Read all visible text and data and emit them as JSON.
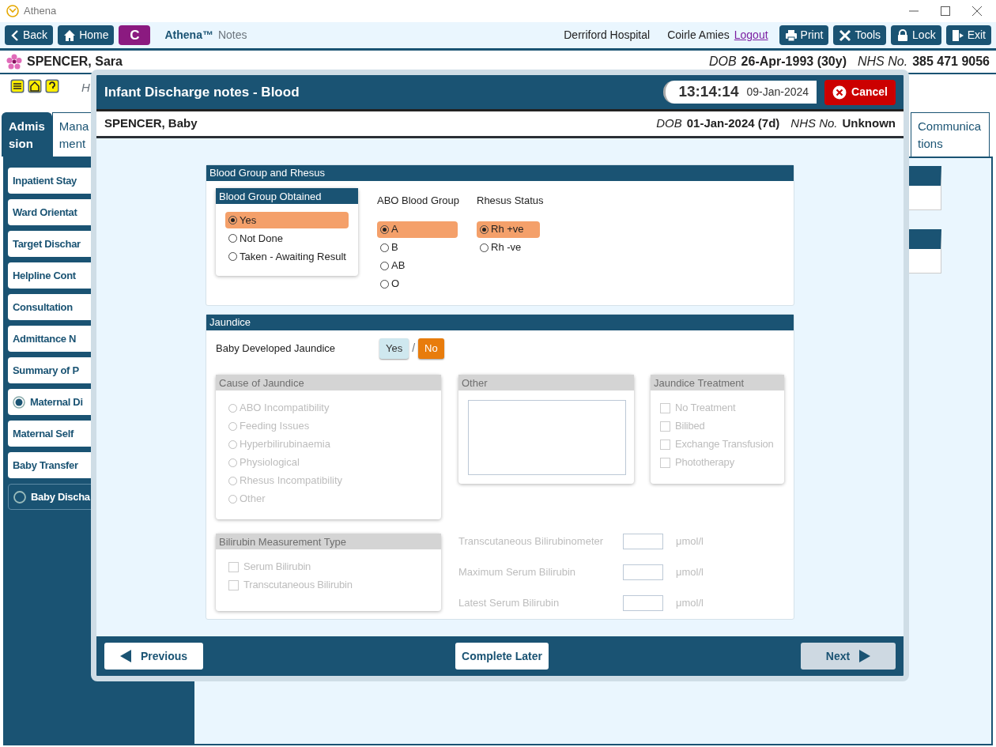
{
  "app": {
    "title": "Athena"
  },
  "toolbar": {
    "left_buttons": [
      {
        "label": "Back"
      },
      {
        "label": "Home"
      }
    ],
    "badge": "C",
    "brand": "Athena™",
    "brand_suffix": "Notes",
    "hospital": "Derriford Hospital",
    "user": "Coirle Amies",
    "logout": "Logout",
    "right_buttons": [
      {
        "label": "Print"
      },
      {
        "label": "Tools"
      },
      {
        "label": "Lock"
      },
      {
        "label": "Exit"
      }
    ]
  },
  "patient": {
    "name": "SPENCER, Sara",
    "dob_label": "DOB",
    "dob": "26-Apr-1993 (30y)",
    "nhs_label": "NHS No.",
    "nhs": "385 471 9056"
  },
  "hint_text": "H",
  "tabs": [
    {
      "lines": [
        "Admis",
        "sion"
      ],
      "selected": true
    },
    {
      "lines": [
        "Mana",
        "ment"
      ],
      "selected": false
    },
    {
      "lines": [
        "Communica",
        "tions"
      ],
      "selected": false
    }
  ],
  "sidebar": {
    "items": [
      {
        "label": "Inpatient Stay",
        "selected": false,
        "kind": "plain"
      },
      {
        "label": "Ward Orientat",
        "selected": false,
        "kind": "plain"
      },
      {
        "label": "Target Dischar",
        "selected": false,
        "kind": "plain"
      },
      {
        "label": "Helpline Cont",
        "selected": false,
        "kind": "plain"
      },
      {
        "label": "Consultation",
        "selected": false,
        "kind": "plain"
      },
      {
        "label": "Admittance N",
        "selected": false,
        "kind": "plain"
      },
      {
        "label": "Summary of P",
        "selected": false,
        "kind": "plain"
      },
      {
        "label": "Maternal Di",
        "selected": false,
        "kind": "filled"
      },
      {
        "label": "Maternal Self",
        "selected": false,
        "kind": "plain"
      },
      {
        "label": "Baby Transfer",
        "selected": false,
        "kind": "plain"
      },
      {
        "label": "Baby Discha",
        "selected": true,
        "kind": "empty"
      }
    ]
  },
  "modal": {
    "title": "Infant Discharge notes - Blood",
    "time": "13:14:14",
    "date": "09-Jan-2024",
    "cancel": "Cancel",
    "baby": {
      "name": "SPENCER, Baby",
      "dob_label": "DOB",
      "dob": "01-Jan-2024 (7d)",
      "nhs_label": "NHS No.",
      "nhs": "Unknown"
    },
    "blood_section": {
      "title": "Blood Group and Rhesus",
      "obtained": {
        "title": "Blood Group Obtained",
        "options": [
          {
            "label": "Yes",
            "selected": true
          },
          {
            "label": "Not Done",
            "selected": false
          },
          {
            "label": "Taken - Awaiting Result",
            "selected": false
          }
        ]
      },
      "abo": {
        "title": "ABO Blood Group",
        "options": [
          {
            "label": "A",
            "selected": true
          },
          {
            "label": "B",
            "selected": false
          },
          {
            "label": "AB",
            "selected": false
          },
          {
            "label": "O",
            "selected": false
          }
        ]
      },
      "rhesus": {
        "title": "Rhesus Status",
        "options": [
          {
            "label": "Rh +ve",
            "selected": true
          },
          {
            "label": "Rh -ve",
            "selected": false
          }
        ]
      }
    },
    "jaundice_section": {
      "title": "Jaundice",
      "question": "Baby Developed Jaundice",
      "separator": "/",
      "answers": [
        {
          "label": "Yes",
          "selected": false
        },
        {
          "label": "No",
          "selected": true
        }
      ],
      "cause": {
        "title": "Cause of Jaundice",
        "disabled": true,
        "options": [
          {
            "label": "ABO Incompatibility",
            "selected": false
          },
          {
            "label": "Feeding Issues",
            "selected": false
          },
          {
            "label": "Hyperbilirubinaemia",
            "selected": false
          },
          {
            "label": "Physiological",
            "selected": false
          },
          {
            "label": "Rhesus Incompatibility",
            "selected": false
          },
          {
            "label": "Other",
            "selected": false
          }
        ]
      },
      "other": {
        "title": "Other",
        "disabled": true
      },
      "treatment": {
        "title": "Jaundice Treatment",
        "disabled": true,
        "options": [
          {
            "label": "No Treatment",
            "checked": false
          },
          {
            "label": "Bilibed",
            "checked": false
          },
          {
            "label": "Exchange Transfusion",
            "checked": false
          },
          {
            "label": "Phototherapy",
            "checked": false
          }
        ]
      },
      "measurement_type": {
        "title": "Bilirubin Measurement Type",
        "disabled": true,
        "options": [
          {
            "label": "Serum Bilirubin",
            "checked": false
          },
          {
            "label": "Transcutaneous Bilirubin",
            "checked": false
          }
        ]
      },
      "measurements": [
        {
          "label": "Transcutaneous Bilirubinometer",
          "unit": "μmol/l",
          "disabled": true
        },
        {
          "label": "Maximum Serum Bilirubin",
          "unit": "μmol/l",
          "disabled": true
        },
        {
          "label": "Latest Serum Bilirubin",
          "unit": "μmol/l",
          "disabled": true
        }
      ]
    },
    "footer": {
      "previous": {
        "label": "Previous",
        "disabled": false
      },
      "complete_later": {
        "label": "Complete Later",
        "disabled": false
      },
      "next": {
        "label": "Next",
        "disabled": true
      }
    }
  }
}
